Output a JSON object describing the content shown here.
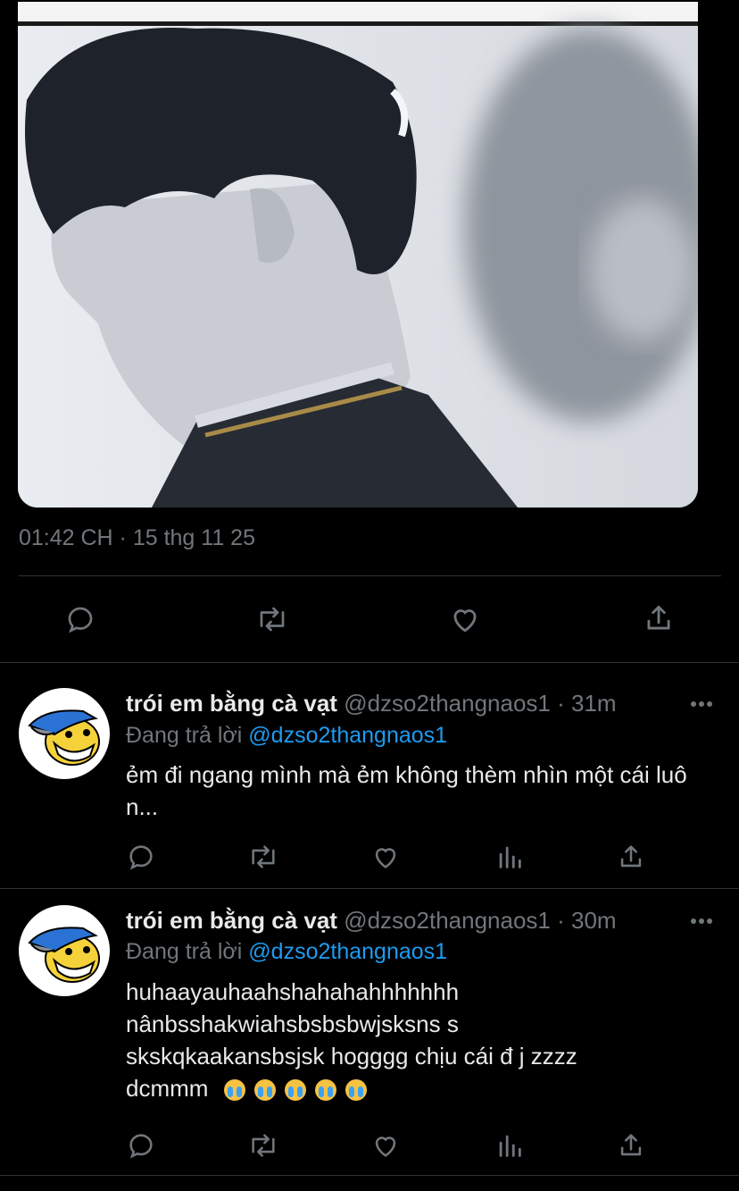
{
  "tweet": {
    "timestamp": "01:42 CH · 15 thg 11 25",
    "actions": [
      "reply-icon",
      "retweet-icon",
      "like-icon",
      "share-icon"
    ]
  },
  "replies": [
    {
      "name": "trói em bằng cà vạt",
      "handle": "@dzso2thangnaos1",
      "time": "· 31m",
      "replying_prefix": "Đang trả lời",
      "replying_to": "@dzso2thangnaos1",
      "text": "ẻm đi ngang mình mà ẻm không thèm nhìn một cái luôn...",
      "emoji_count": 0
    },
    {
      "name": "trói em bằng cà vạt",
      "handle": "@dzso2thangnaos1",
      "time": "· 30m",
      "replying_prefix": "Đang trả lời",
      "replying_to": "@dzso2thangnaos1",
      "text": "huhaayauhaahshahahahhhhhhh nânbsshakwiahsbsbsbwjsksns s skskqkaakansbsjsk hogggg chịu cái đ j zzzz dcmmm",
      "emoji_count": 5
    }
  ],
  "colors": {
    "background": "#000000",
    "text": "#e7e9ea",
    "muted": "#71767b",
    "link": "#1d9bf0"
  }
}
